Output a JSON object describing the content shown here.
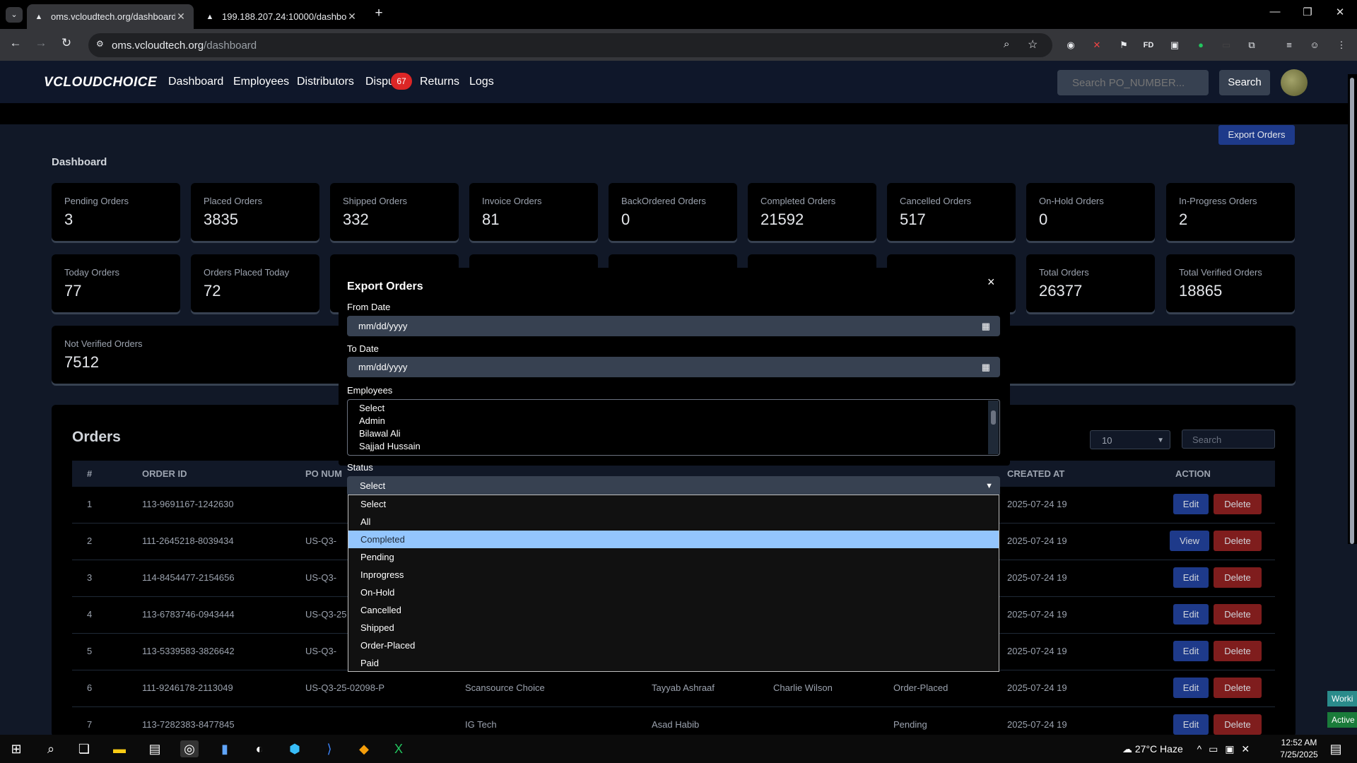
{
  "browser": {
    "tabs": [
      {
        "title": "oms.vcloudtech.org/dashboard",
        "active": true
      },
      {
        "title": "199.188.207.24:10000/dashboa",
        "active": false
      }
    ],
    "url_host": "oms.vcloudtech.org",
    "url_path": "/dashboard"
  },
  "navbar": {
    "logo": "CLOUDCHOICE",
    "links": [
      "Dashboard",
      "Employees",
      "Distributors",
      "Dispu",
      "Returns",
      "Logs"
    ],
    "disputes_badge": "67",
    "search_placeholder": "Search PO_NUMBER...",
    "search_button": "Search"
  },
  "page": {
    "export_button": "Export Orders",
    "title": "Dashboard",
    "stats_row1": [
      {
        "label": "Pending Orders",
        "value": "3"
      },
      {
        "label": "Placed Orders",
        "value": "3835"
      },
      {
        "label": "Shipped Orders",
        "value": "332"
      },
      {
        "label": "Invoice Orders",
        "value": "81"
      },
      {
        "label": "BackOrdered Orders",
        "value": "0"
      },
      {
        "label": "Completed Orders",
        "value": "21592"
      },
      {
        "label": "Cancelled Orders",
        "value": "517"
      },
      {
        "label": "On-Hold Orders",
        "value": "0"
      },
      {
        "label": "In-Progress Orders",
        "value": "2"
      }
    ],
    "stats_row2": [
      {
        "label": "Today Orders",
        "value": "77"
      },
      {
        "label": "Orders Placed Today",
        "value": "72"
      },
      {
        "label": "Total Orders",
        "value": "26377"
      },
      {
        "label": "Total Verified Orders",
        "value": "18865"
      }
    ],
    "stats_row3": [
      {
        "label": "Not Verified Orders",
        "value": "7512"
      }
    ],
    "orders": {
      "title": "Orders",
      "page_size": "10",
      "search_placeholder": "Search",
      "columns": [
        "#",
        "ORDER ID",
        "PO NUM",
        "CREATED AT",
        "ACTION"
      ],
      "rows": [
        {
          "n": "1",
          "order_id": "113-9691167-1242630",
          "po": "",
          "distributor": "",
          "employee": "",
          "customer": "",
          "status": "",
          "created": "2025-07-24 19",
          "primary": "Edit"
        },
        {
          "n": "2",
          "order_id": "111-2645218-8039434",
          "po": "US-Q3-",
          "distributor": "",
          "employee": "",
          "customer": "",
          "status": "",
          "created": "2025-07-24 19",
          "primary": "View"
        },
        {
          "n": "3",
          "order_id": "114-8454477-2154656",
          "po": "US-Q3-",
          "distributor": "",
          "employee": "",
          "customer": "",
          "status": "",
          "created": "2025-07-24 19",
          "primary": "Edit"
        },
        {
          "n": "4",
          "order_id": "113-6783746-0943444",
          "po": "US-Q3-25",
          "distributor": "",
          "employee": "",
          "customer": "",
          "status": "",
          "created": "2025-07-24 19",
          "primary": "Edit"
        },
        {
          "n": "5",
          "order_id": "113-5339583-3826642",
          "po": "US-Q3-",
          "distributor": "",
          "employee": "",
          "customer": "",
          "status": "",
          "created": "2025-07-24 19",
          "primary": "Edit"
        },
        {
          "n": "6",
          "order_id": "111-9246178-2113049",
          "po": "US-Q3-25-02098-P",
          "distributor": "Scansource Choice",
          "employee": "Tayyab Ashraaf",
          "customer": "Charlie Wilson",
          "status": "Order-Placed",
          "created": "2025-07-24 19",
          "primary": "Edit"
        },
        {
          "n": "7",
          "order_id": "113-7282383-8477845",
          "po": "",
          "distributor": "IG Tech",
          "employee": "Asad Habib",
          "customer": "",
          "status": "Pending",
          "created": "2025-07-24 19",
          "primary": "Edit"
        }
      ],
      "delete_label": "Delete"
    }
  },
  "modal": {
    "title": "Export Orders",
    "close": "×",
    "from_label": "From Date",
    "from_value": "mm/dd/yyyy",
    "to_label": "To Date",
    "to_value": "mm/dd/yyyy",
    "employees_label": "Employees",
    "employees": [
      "Select",
      "Admin",
      "Bilawal Ali",
      "Sajjad Hussain"
    ],
    "status_label": "Status",
    "status_value": "Select",
    "status_options": [
      "Select",
      "All",
      "Completed",
      "Pending",
      "Inprogress",
      "On-Hold",
      "Cancelled",
      "Shipped",
      "Order-Placed",
      "Paid"
    ],
    "highlighted_option": "Completed"
  },
  "taskbar": {
    "weather": "27°C  Haze",
    "time": "12:52 AM",
    "date": "7/25/2025"
  },
  "side_notes": [
    "Worki",
    "Active"
  ]
}
